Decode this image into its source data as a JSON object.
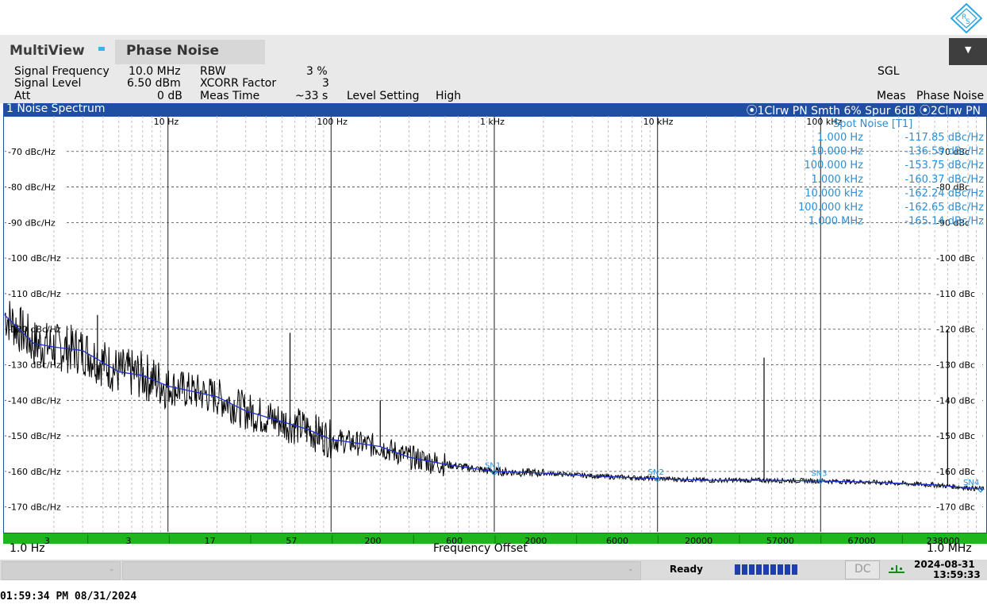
{
  "app": {
    "title": "MultiView",
    "tab": "Phase Noise",
    "mode": "SGL"
  },
  "icons": {
    "logo": "rs-diamond-logo",
    "menu": "chevron-down-icon",
    "level": "level-indicator-icon"
  },
  "colors": {
    "panel_bar": "#1f4fa0",
    "trace_black": "#000000",
    "trace_blue": "#1c2fd0",
    "marker": "#2a8fd6",
    "strip": "#1fb51f"
  },
  "settings": {
    "signal_frequency_label": "Signal Frequency",
    "signal_frequency": "10.0 MHz",
    "signal_level_label": "Signal Level",
    "signal_level": "6.50 dBm",
    "att_label": "Att",
    "att": "0 dB",
    "rbw_label": "RBW",
    "rbw": "3 %",
    "xcorr_label": "XCORR Factor",
    "xcorr": "3",
    "meas_time_label": "Meas Time",
    "meas_time": "~33 s",
    "level_setting_label": "Level Setting",
    "level_setting": "High",
    "meas_label": "Meas",
    "meas": "Phase Noise"
  },
  "panel": {
    "title": "1 Noise Spectrum",
    "traces": "⦿1Clrw PN Smth 6% Spur 6dB ⦿2Clrw PN"
  },
  "chart_data": {
    "type": "line",
    "xscale": "log",
    "xlim": [
      1,
      1000000
    ],
    "ylim": [
      -177,
      -60
    ],
    "x_ticks": [
      "10 Hz",
      "100 Hz",
      "1 kHz",
      "10 kHz",
      "100 kHz"
    ],
    "x_tick_values": [
      10,
      100,
      1000,
      10000,
      100000
    ],
    "y_ticks_left": [
      "-70 dBc/Hz",
      "-80 dBc/Hz",
      "-90 dBc/Hz",
      "-100 dBc/Hz",
      "-110 dBc/Hz",
      "-120 dBc/Hz",
      "-130 dBc/Hz",
      "-140 dBc/Hz",
      "-150 dBc/Hz",
      "-160 dBc/Hz",
      "-170 dBc/Hz"
    ],
    "y_ticks_right": [
      "-70 dBc",
      "-80 dBc",
      "-90 dBc",
      "-100 dBc",
      "-110 dBc",
      "-120 dBc",
      "-130 dBc",
      "-140 dBc",
      "-150 dBc",
      "-160 dBc",
      "-170 dBc"
    ],
    "y_tick_values": [
      -70,
      -80,
      -90,
      -100,
      -110,
      -120,
      -130,
      -140,
      -150,
      -160,
      -170
    ],
    "xlabel": "Frequency Offset",
    "x_start": "1.0 Hz",
    "x_end": "1.0 MHz",
    "series": [
      {
        "x": [
          1,
          1.5,
          2,
          3,
          5,
          7,
          10,
          20,
          30,
          50,
          70,
          100,
          200,
          300,
          500,
          700,
          1000,
          2000,
          5000,
          10000,
          20000,
          50000,
          100000,
          200000,
          500000,
          1000000
        ],
        "y": [
          -116,
          -124,
          -125,
          -126,
          -132,
          -133,
          -136,
          -139,
          -143,
          -146,
          -148,
          -151,
          -153,
          -156,
          -158,
          -159,
          -160,
          -160.5,
          -161.5,
          -162,
          -162.5,
          -162.5,
          -162.7,
          -163,
          -163.8,
          -165
        ]
      }
    ],
    "spurs": [
      {
        "x": 3.7,
        "y": -116
      },
      {
        "x": 56,
        "y": -121
      },
      {
        "x": 200,
        "y": -140
      },
      {
        "x": 45000,
        "y": -128
      },
      {
        "x": 600000,
        "y": -120
      }
    ],
    "spot_markers": [
      {
        "label": "SN1",
        "x": 1000,
        "y": -160.37
      },
      {
        "label": "SN2",
        "x": 10000,
        "y": -162.24
      },
      {
        "label": "SN3",
        "x": 100000,
        "y": -162.65
      },
      {
        "label": "SN4",
        "x": 1000000,
        "y": -165.14
      }
    ],
    "spot_noise_title": "Spot Noise [T1]",
    "spot_noise": [
      {
        "freq": "1.000 Hz",
        "value": "-117.85 dBc/Hz"
      },
      {
        "freq": "10.000 Hz",
        "value": "-136.59 dBc/Hz"
      },
      {
        "freq": "100.000 Hz",
        "value": "-153.75 dBc/Hz"
      },
      {
        "freq": "1.000 kHz",
        "value": "-160.37 dBc/Hz"
      },
      {
        "freq": "10.000 kHz",
        "value": "-162.24 dBc/Hz"
      },
      {
        "freq": "100.000 kHz",
        "value": "-162.65 dBc/Hz"
      },
      {
        "freq": "1.000 MHz",
        "value": "-165.14 dBc/Hz"
      }
    ],
    "strip_labels": [
      "3",
      "3",
      "17",
      "57",
      "200",
      "600",
      "2000",
      "6000",
      "20000",
      "57000",
      "67000",
      "238000"
    ]
  },
  "status": {
    "state": "Ready",
    "coupling": "DC",
    "date": "2024-08-31",
    "time": "13:59:33"
  },
  "footer": {
    "timestamp": "01:59:34 PM  08/31/2024"
  }
}
